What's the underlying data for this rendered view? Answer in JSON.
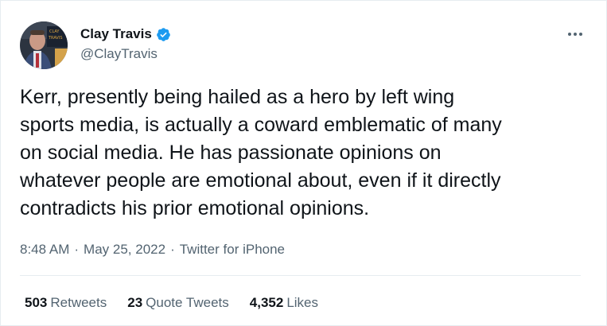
{
  "author": {
    "display_name": "Clay Travis",
    "handle": "@ClayTravis",
    "verified": true,
    "avatar_icon": "profile-photo",
    "avatar_sign_text": "CLAY TRAVIS"
  },
  "tweet": {
    "text": "Kerr, presently being hailed as a hero by left wing\nsports media, is actually a coward emblematic of many\non social media. He has passionate opinions on\nwhatever people are emotional about, even if it directly\ncontradicts his prior emotional opinions.",
    "time": "8:48 AM",
    "separator": "·",
    "date": "May 25, 2022",
    "source": "Twitter for iPhone"
  },
  "stats": {
    "retweets_count": "503",
    "retweets_label": "Retweets",
    "quotes_count": "23",
    "quotes_label": "Quote Tweets",
    "likes_count": "4,352",
    "likes_label": "Likes"
  },
  "icons": {
    "more": "more-horizontal-icon",
    "verified": "verified-badge-icon"
  },
  "colors": {
    "text_primary": "#0f1419",
    "text_secondary": "#536471",
    "verified_blue": "#1d9bf0",
    "divider": "#e6ecf0"
  }
}
